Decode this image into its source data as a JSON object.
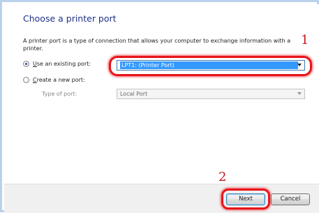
{
  "page": {
    "title": "Choose a printer port",
    "description": "A printer port is a type of connection that allows your computer to exchange information with a printer."
  },
  "options": {
    "existing": {
      "label_underlined": "U",
      "label_rest": "se an existing port:",
      "selected": true,
      "port_value": "LPT1: (Printer Port)"
    },
    "new": {
      "label_underlined": "C",
      "label_rest": "reate a new port:",
      "selected": false,
      "type_label": "Type of port:",
      "type_value": "Local Port"
    }
  },
  "annotations": {
    "marker_1": "1",
    "marker_2": "2",
    "highlight_color": "#e8141a"
  },
  "footer": {
    "next_label": "Next",
    "cancel_label": "Cancel"
  },
  "colors": {
    "title": "#1e3287",
    "selection": "#3399ff",
    "border": "#b9d1ea"
  }
}
